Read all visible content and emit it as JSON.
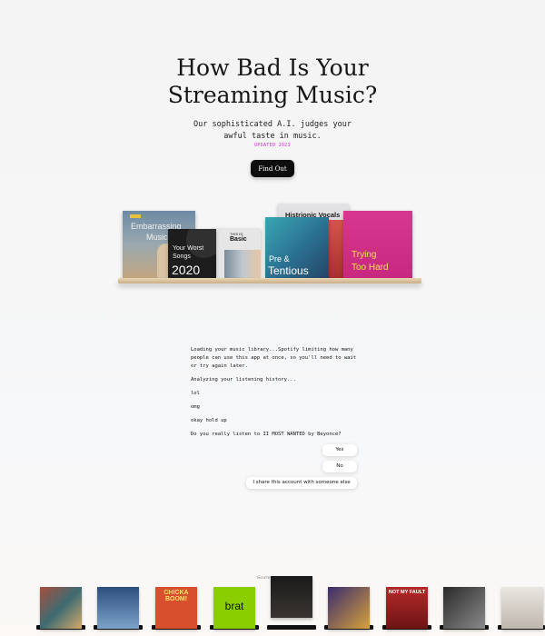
{
  "hero": {
    "title_line1": "How Bad Is Your",
    "title_line2": "Streaming Music?",
    "subtitle_line1": "Our sophisticated A.I. judges your",
    "subtitle_line2": "awful taste in music.",
    "updated": "UPDATED 2023",
    "cta": "Find Out"
  },
  "shelf": {
    "albums": [
      {
        "title": "Embarrassing Music",
        "line1": "Embarrassing",
        "line2": "Music"
      },
      {
        "title": "Your Worst Songs 2020",
        "line1": "Your Worst",
        "line2": "Songs",
        "line3": "2020"
      },
      {
        "title": "This is Basic",
        "line1": "THIS IS",
        "line2": "Basic"
      },
      {
        "title": "Histrionic Vocals",
        "line1": "Histrionic Vocals"
      },
      {
        "title": "Pre & Tentious",
        "line1": "Pre &",
        "line2": "Tentious"
      },
      {
        "title": "Trying Too Hard",
        "line1": "Trying",
        "line2": "Too Hard"
      }
    ]
  },
  "conversation": {
    "messages": [
      "Loading your music library...Spotify limiting how many people can use this app at once, so you'll need to wait or try again later.",
      "Analyzing your listening history...",
      "lol",
      "omg",
      "okay hold up",
      "Do you really listen to II MOST WANTED by Beyoncé?"
    ],
    "replies": [
      "Yes",
      "No",
      "I share this account with someone else"
    ]
  },
  "scroll_label": "Scores",
  "bottom_covers": [
    {
      "name": "cover-1"
    },
    {
      "name": "cover-2"
    },
    {
      "name": "chicka-boom",
      "text": "CHICKA BOOM!"
    },
    {
      "name": "brat",
      "text": "brat"
    },
    {
      "name": "cover-5"
    },
    {
      "name": "cover-6"
    },
    {
      "name": "not-my-fault",
      "text": "NOT MY FAULT"
    },
    {
      "name": "cover-8"
    },
    {
      "name": "cover-9"
    }
  ],
  "colors": {
    "accent_pink": "#d42bd8",
    "cta_bg": "#0d0d0d",
    "brat_green": "#8ace00"
  }
}
